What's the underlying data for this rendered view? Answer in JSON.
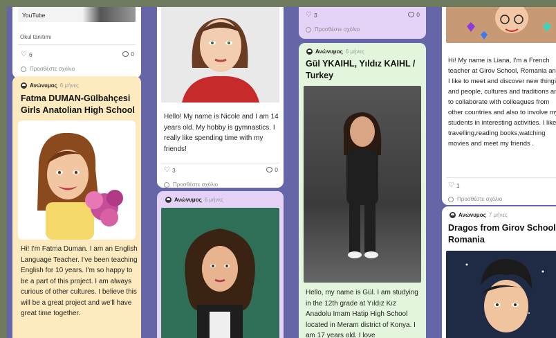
{
  "meta": {
    "anon": "Ανώνυμος",
    "comment_placeholder": "Προσθέστε σχόλιο"
  },
  "col1": {
    "top": {
      "source": "YouTube",
      "caption": "Okul tanıtımı",
      "likes": "6",
      "comments": "0"
    },
    "fatma": {
      "time": "6 μήνες",
      "title": "Fatma DUMAN-Gülbahçesi Girls Anatolian High School",
      "body": "Hi! I'm Fatma Duman. I am an English Language Teacher. I've been teaching English for 10 years. I'm so happy to be a part of this project. I am always curious of other cultures. I believe this will be a great project and we'll have great time together."
    }
  },
  "col2": {
    "nicole": {
      "body": "Hello! My name is Nicole and I am 14 years old. My hobby is gymnastics. I really like spending time with my friends!",
      "likes": "3",
      "comments": "0"
    },
    "curly": {
      "time": "6 μήνες"
    }
  },
  "col3": {
    "top": {
      "likes": "3",
      "comments": "0"
    },
    "gul": {
      "time": "6 μήνες",
      "title": "Gül YKAIHL, Yıldız KAIHL / Turkey",
      "body": "Hello, my name is Gül. I am studying in the 12th grade at Yıldız Kız Anadolu Imam Hatip High School located in Meram district of Konya. I am 17 years old. I love"
    }
  },
  "col4": {
    "liana": {
      "body": "Hi! My name is Liana, I'm a French teacher at Girov School, Romania and I like to meet and discover new things and people, cultures and traditions and to collaborate with colleagues from other countries and also to involve my students in interesting activities. I like travelling,reading books,watching movies and meet my friends .",
      "likes": "1"
    },
    "dragos": {
      "time": "7 μήνες",
      "title": "Dragos from Girov School Romania"
    }
  },
  "colors": {
    "wall": "#6566a8",
    "outer": "#6d7a5e",
    "yellow": "#fdebbf",
    "lavender": "#e4d3f7",
    "green": "#e3f5dc"
  }
}
